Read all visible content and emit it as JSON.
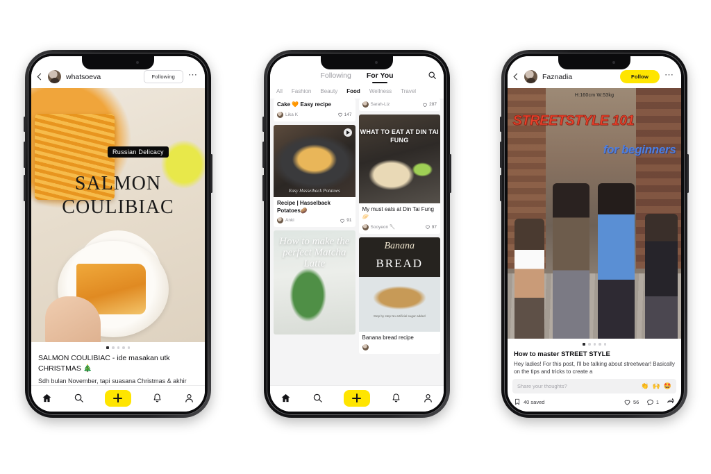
{
  "app": {
    "accent_yellow": "#ffe500",
    "background": "#ffffff"
  },
  "phone1": {
    "header": {
      "back_icon": "chevron-left-icon",
      "username": "whatsoeva",
      "follow_label": "Following",
      "more_icon": "more-horizontal-icon"
    },
    "post": {
      "badge": "Russian Delicacy",
      "hero_line1": "SALMON",
      "hero_line2": "COULIBIAC",
      "caption_title": "SALMON COULIBIAC - ide masakan utk CHRISTMAS 🎄",
      "caption_body": "Sdh bulan November, tapi suasana Christmas & akhir",
      "dots_total": 5,
      "dots_active": 1
    },
    "tabbar": {
      "items": [
        {
          "icon": "home-icon",
          "label": "Home",
          "active": true
        },
        {
          "icon": "search-icon",
          "label": "Search",
          "active": false
        },
        {
          "icon": "plus-icon",
          "label": "Create",
          "active": false
        },
        {
          "icon": "bell-icon",
          "label": "Notifications",
          "active": false
        },
        {
          "icon": "person-icon",
          "label": "Profile",
          "active": false
        }
      ]
    }
  },
  "phone2": {
    "segments": [
      {
        "label": "Following",
        "active": false
      },
      {
        "label": "For You",
        "active": true
      }
    ],
    "search_icon": "search-icon",
    "chips": [
      {
        "label": "All",
        "active": false
      },
      {
        "label": "Fashion",
        "active": false
      },
      {
        "label": "Beauty",
        "active": false
      },
      {
        "label": "Food",
        "active": true
      },
      {
        "label": "Wellness",
        "active": false
      },
      {
        "label": "Travel",
        "active": false
      }
    ],
    "left_column": [
      {
        "title": "Cake 🧡 Easy recipe",
        "user": "Lika K",
        "likes": "147",
        "image": "cake-thumbnail",
        "overlay": "",
        "has_video": false,
        "image_caption": ""
      },
      {
        "title": "Recipe | Hasselback Potatoes🥔",
        "user": "Anki",
        "likes": "91",
        "image": "hasselback-potatoes-thumbnail",
        "overlay": "",
        "has_video": true,
        "image_caption": "Easy Hasselback Potatoes"
      },
      {
        "title": "",
        "user": "",
        "likes": "",
        "image": "matcha-latte-thumbnail",
        "overlay": "How to make the perfect Matcha Latte",
        "has_video": false,
        "image_caption": ""
      }
    ],
    "right_column": [
      {
        "title": "",
        "user": "Sarah-Liz",
        "likes": "287",
        "image": "sarah-liz-thumbnail",
        "overlay": "",
        "has_video": false,
        "image_caption": ""
      },
      {
        "title": "My must eats at Din Tai Fung 🥟",
        "user": "Sooyeon 🥄",
        "likes": "97",
        "image": "din-tai-fung-thumbnail",
        "overlay": "WHAT TO EAT AT DIN TAI FUNG",
        "has_video": false,
        "image_caption": ""
      },
      {
        "title": "Banana bread recipe",
        "user": "",
        "likes": "",
        "image": "banana-bread-thumbnail",
        "overlay_script": "Banana",
        "overlay_bold": "BREAD",
        "overlay_sub": "Step by step\nNo artificial sugar added",
        "has_video": false,
        "image_caption": ""
      }
    ],
    "tabbar": {
      "items": [
        {
          "icon": "home-icon",
          "label": "Home",
          "active": true
        },
        {
          "icon": "search-icon",
          "label": "Search",
          "active": false
        },
        {
          "icon": "plus-icon",
          "label": "Create",
          "active": false
        },
        {
          "icon": "bell-icon",
          "label": "Notifications",
          "active": false
        },
        {
          "icon": "person-icon",
          "label": "Profile",
          "active": false
        }
      ]
    }
  },
  "phone3": {
    "header": {
      "back_icon": "chevron-left-icon",
      "username": "Faznadia",
      "follow_label": "Follow",
      "more_icon": "more-horizontal-icon"
    },
    "post": {
      "measurements": "H:160cm W:53kg",
      "hero_title": "STREETSTYLE 101",
      "hero_sub": "for beginners",
      "caption_title": "How to master STREET STYLE",
      "caption_body": "Hey ladies! For this post, I'll be talking about streetwear! Basically on the tips and tricks to create a",
      "dots_total": 5,
      "dots_active": 1
    },
    "comment": {
      "placeholder": "Share your thoughts?",
      "emojis": [
        "👏",
        "🙌",
        "🤩"
      ]
    },
    "actions": {
      "save_icon": "bookmark-icon",
      "saved_label": "40 saved",
      "like_icon": "heart-icon",
      "likes": "56",
      "comment_icon": "comment-icon",
      "comments": "1",
      "share_icon": "share-icon"
    }
  }
}
